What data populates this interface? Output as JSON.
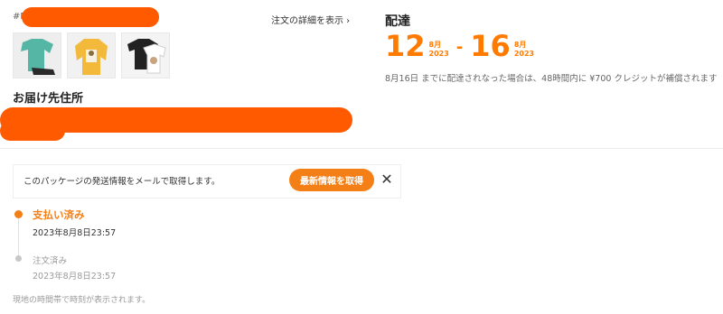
{
  "order": {
    "id_prefix": "#P",
    "details_link": "注文の詳細を表示 ›",
    "address_title": "お届け先住所",
    "thumbnails": [
      "green-shirt",
      "yellow-sweater",
      "black-white-shirt"
    ]
  },
  "delivery": {
    "title": "配達",
    "start_day": "12",
    "start_month": "8月",
    "start_year": "2023",
    "separator": "-",
    "end_day": "16",
    "end_month": "8月",
    "end_year": "2023",
    "note": "8月16日 までに配達されなった場合は、48時間内に ¥700 クレジットが補償されます",
    "accent_color": "#ff7a00"
  },
  "notify": {
    "text": "このパッケージの発送情報をメールで取得します。",
    "button_label": "最新情報を取得",
    "close_label": "✕"
  },
  "timeline": [
    {
      "label": "支払い済み",
      "time": "2023年8月8日23:57"
    },
    {
      "label": "注文済み",
      "time": "2023年8月8日23:57"
    }
  ],
  "footer_note": "現地の時間帯で時刻が表示されます。"
}
